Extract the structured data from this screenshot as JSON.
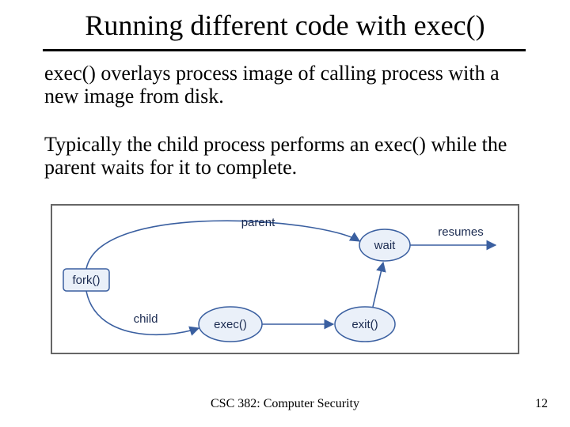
{
  "title": "Running different code with exec()",
  "paragraph1": "exec() overlays process image of calling process with a new image from disk.",
  "paragraph2": "Typically the child process performs an exec() while the parent waits for it to complete.",
  "diagram": {
    "labels": {
      "parent": "parent",
      "child": "child",
      "resumes": "resumes"
    },
    "nodes": {
      "fork": "fork()",
      "wait": "wait",
      "exec": "exec()",
      "exit": "exit()"
    }
  },
  "footer": {
    "center": "CSC 382: Computer Security",
    "page": "12"
  },
  "chart_data": {
    "type": "diagram",
    "title": "fork/exec/wait process flow",
    "nodes": [
      {
        "id": "fork",
        "label": "fork()"
      },
      {
        "id": "wait",
        "label": "wait"
      },
      {
        "id": "exec",
        "label": "exec()"
      },
      {
        "id": "exit",
        "label": "exit()"
      }
    ],
    "edges": [
      {
        "from": "fork",
        "to": "wait",
        "label": "parent"
      },
      {
        "from": "wait",
        "to": "resumes",
        "label": "resumes"
      },
      {
        "from": "fork",
        "to": "exec",
        "label": "child"
      },
      {
        "from": "exec",
        "to": "exit",
        "label": ""
      },
      {
        "from": "exit",
        "to": "wait",
        "label": ""
      }
    ]
  }
}
